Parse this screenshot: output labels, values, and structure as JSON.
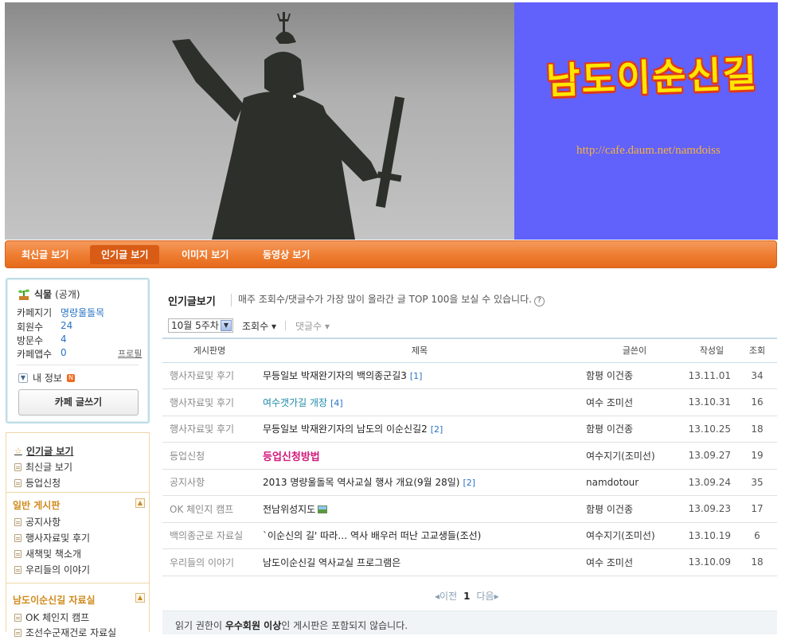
{
  "banner": {
    "title": "남도이순신길",
    "url": "http://cafe.daum.net/namdoiss"
  },
  "nav": {
    "items": [
      "최신글 보기",
      "인기글 보기",
      "이미지 보기",
      "동영상 보기"
    ],
    "active_index": 1
  },
  "cafe_info": {
    "grade_name": "식물",
    "grade_status": "(공개)",
    "rows": [
      {
        "label": "카페지기",
        "value": "명량울돌목"
      },
      {
        "label": "회원수",
        "value": "24"
      },
      {
        "label": "방문수",
        "value": "4"
      },
      {
        "label": "카페앱수",
        "value": "0"
      }
    ],
    "profile_link": "프로필",
    "my_info": "내 정보",
    "new_badge": "N",
    "write_button": "카페 글쓰기"
  },
  "sidebar": {
    "top_items": [
      {
        "label": "인기글 보기",
        "icon": "star-icon"
      },
      {
        "label": "최신글 보기",
        "icon": "board-icon"
      },
      {
        "label": "등업신청",
        "icon": "board-icon"
      }
    ],
    "section1": {
      "title": "일반 게시판",
      "items": [
        "공지사항",
        "행사자료및 후기",
        "새책및 책소개",
        "우리들의 이야기"
      ]
    },
    "section2": {
      "title": "남도이순신길 자료실",
      "items": [
        "OK 체인지 캠프",
        "조선수군재건로 자료실"
      ]
    },
    "toggle_label": "▲"
  },
  "main": {
    "title": "인기글보기",
    "description": "매주 조회수/댓글수가 가장 많이 올라간 글 TOP 100을 보실 수 있습니다.",
    "week_select": "10월 5주차",
    "sort_views": "조회수",
    "sort_comments": "댓글수",
    "columns": [
      "게시판명",
      "제목",
      "글쓴이",
      "작성일",
      "조회"
    ],
    "rows": [
      {
        "board": "행사자료및 후기",
        "subject": "무등일보 박재완기자의 백의종군길3",
        "comments": "[1]",
        "author": "함평 이건종",
        "date": "13.11.01",
        "views": "34",
        "style": "normal"
      },
      {
        "board": "행사자료및 후기",
        "subject": "여수갯가길 개장",
        "comments": "[4]",
        "author": "여수 조미선",
        "date": "13.10.31",
        "views": "16",
        "style": "teal"
      },
      {
        "board": "행사자료및 후기",
        "subject": "무등일보 박재완기자의 남도의 이순신길2",
        "comments": "[2]",
        "author": "함평 이건종",
        "date": "13.10.25",
        "views": "18",
        "style": "normal"
      },
      {
        "board": "등업신청",
        "subject": "등업신청방법",
        "comments": "",
        "author": "여수지기(조미선)",
        "date": "13.09.27",
        "views": "19",
        "style": "pink"
      },
      {
        "board": "공지사항",
        "subject": "2013 명량울돌목 역사교실 행사 개요(9월 28일)",
        "comments": "[2]",
        "author": "namdotour",
        "date": "13.09.24",
        "views": "35",
        "style": "normal"
      },
      {
        "board": "OK 체인지 캠프",
        "subject": "전남위성지도",
        "comments": "",
        "author": "함평 이건종",
        "date": "13.09.23",
        "views": "17",
        "style": "image"
      },
      {
        "board": "백의종군로 자료실",
        "subject": "`이순신의 길' 따라… 역사 배우러 떠난 고교생들(조선)",
        "comments": "",
        "author": "여수지기(조미선)",
        "date": "13.10.19",
        "views": "6",
        "style": "normal"
      },
      {
        "board": "우리들의 이야기",
        "subject": "남도이순신길 역사교실 프로그램은",
        "comments": "",
        "author": "여수 조미선",
        "date": "13.10.09",
        "views": "18",
        "style": "normal"
      }
    ],
    "pager": {
      "prev": "이전",
      "current": "1",
      "next": "다음"
    },
    "notice_pre": "읽기 권한이 ",
    "notice_bold": "우수회원 이상",
    "notice_post": "인 게시판은 포함되지 않습니다."
  }
}
